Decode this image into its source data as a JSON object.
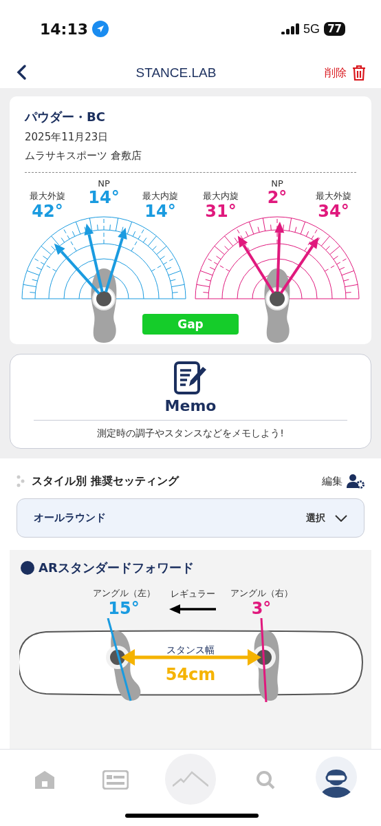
{
  "status_bar": {
    "time": "14:13",
    "network": "5G",
    "battery": "77"
  },
  "nav": {
    "title": "STANCE.LAB",
    "delete_label": "削除"
  },
  "record": {
    "title": "パウダー・BC",
    "date": "2025年11月23日",
    "shop": "ムラサキスポーツ 倉敷店",
    "feet": [
      {
        "color": "#1a9be0",
        "readings": [
          {
            "label": "最大外旋",
            "value": "42°"
          },
          {
            "label": "NP",
            "value": "14°"
          },
          {
            "label": "最大内旋",
            "value": "14°"
          }
        ]
      },
      {
        "color": "#e0197d",
        "readings": [
          {
            "label": "最大内旋",
            "value": "31°"
          },
          {
            "label": "NP",
            "value": "2°"
          },
          {
            "label": "最大外旋",
            "value": "34°"
          }
        ]
      }
    ],
    "gap_button": "Gap"
  },
  "memo": {
    "title": "Memo",
    "hint": "測定時の調子やスタンスなどをメモしよう!"
  },
  "recommend": {
    "heading": "スタイル別 推奨セッティング",
    "edit_label": "編集",
    "style": "オールラウンド",
    "select_label": "選択"
  },
  "setting": {
    "title": "ARスタンダードフォワード",
    "angles": [
      {
        "label": "アングル（左）",
        "value": "15°",
        "color": "#1a9be0"
      },
      {
        "label": "アングル（右）",
        "value": "3°",
        "color": "#e0197d"
      }
    ],
    "direction": "レギュラー",
    "stance_label": "スタンス幅",
    "stance_width": "54cm"
  }
}
